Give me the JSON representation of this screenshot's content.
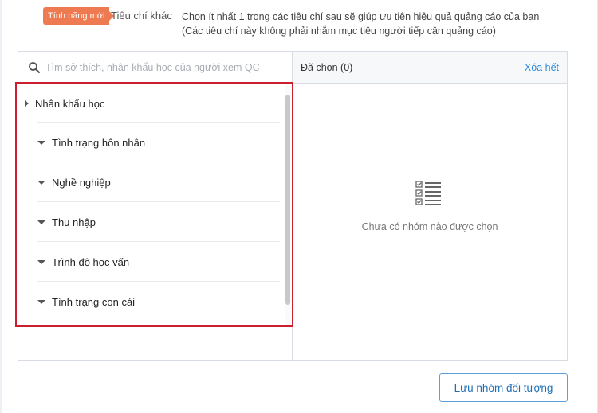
{
  "header": {
    "badge": "Tính năng mới",
    "title": "Tiêu chí khác",
    "description_line1": "Chọn ít nhất 1 trong các tiêu chí sau sẽ giúp ưu tiên hiệu quả quảng cáo của bạn",
    "description_line2": "(Các tiêu chí này không phải nhắm mục tiêu người tiếp cận quảng cáo)"
  },
  "search": {
    "placeholder": "Tìm sở thích, nhân khẩu học của người xem QC",
    "value": ""
  },
  "criteria_list": {
    "parent": {
      "label": "Nhân khẩu học",
      "expanded": false
    },
    "children": [
      {
        "label": "Tình trạng hôn nhân"
      },
      {
        "label": "Nghề nghiệp"
      },
      {
        "label": "Thu nhập"
      },
      {
        "label": "Trình độ học vấn"
      },
      {
        "label": "Tình trạng con cái"
      }
    ]
  },
  "selected_panel": {
    "title": "Đã chọn (0)",
    "clear_all": "Xóa hết",
    "empty_text": "Chưa có nhóm nào được chọn",
    "empty_icon": "checklist-icon"
  },
  "actions": {
    "save_label": "Lưu nhóm đối tượng"
  },
  "colors": {
    "badge": "#ee7a52",
    "link": "#2f88d8",
    "highlight_border": "#cc1f2d",
    "button_border": "#5d9fd9"
  }
}
